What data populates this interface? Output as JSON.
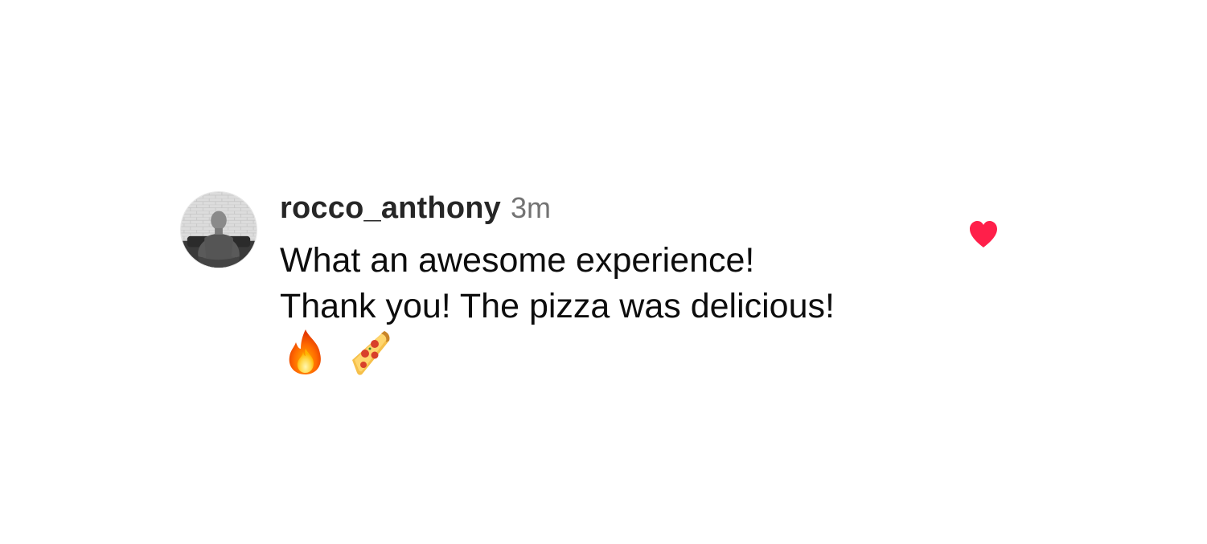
{
  "comment": {
    "username": "rocco_anthony",
    "timestamp": "3m",
    "text_lines": [
      "What an awesome experience!",
      "Thank you! The pizza was delicious!"
    ],
    "emojis": [
      "fire-emoji",
      "pizza-emoji"
    ],
    "liked": true,
    "like_icon": "heart-icon",
    "like_color": "#ff1f4a",
    "avatar_icon": "user-avatar"
  }
}
